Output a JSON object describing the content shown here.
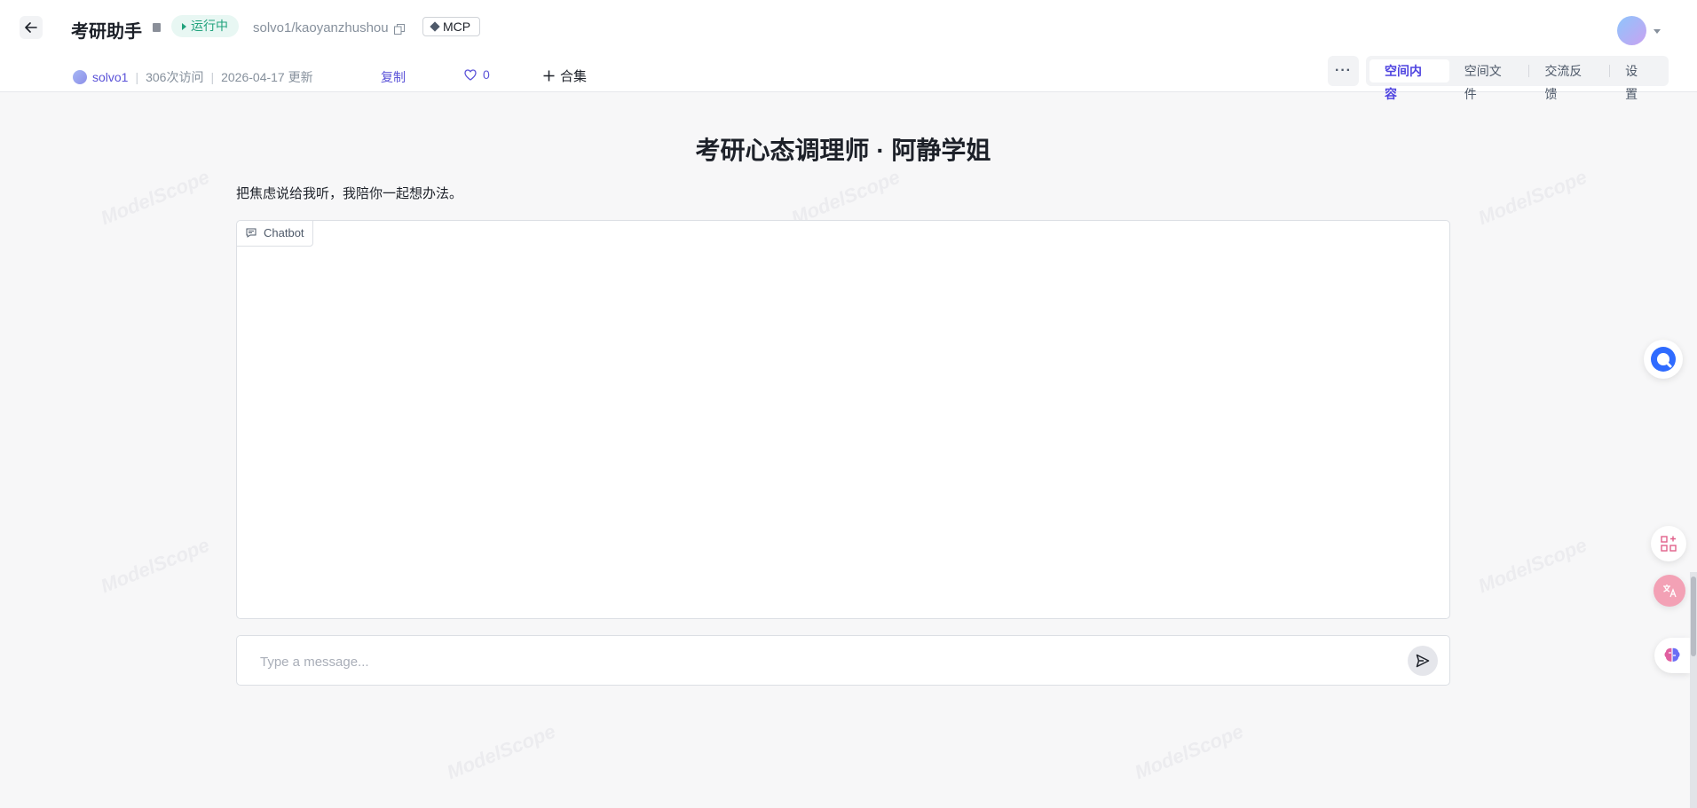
{
  "header": {
    "title": "考研助手",
    "status": "运行中",
    "repo": "solvo1/kaoyanzhushou",
    "badge": "MCP",
    "author": "solvo1",
    "visits": "306次访问",
    "updated": "2026-04-17 更新",
    "copy_label": "复制",
    "likes": "0",
    "collect_label": "合集",
    "more_label": "···"
  },
  "tabs": [
    {
      "label": "空间内容",
      "active": true
    },
    {
      "label": "空间文件",
      "active": false
    },
    {
      "label": "交流反馈",
      "active": false
    },
    {
      "label": "设置",
      "active": false
    }
  ],
  "app": {
    "title": "考研心态调理师 · 阿静学姐",
    "subtitle": "把焦虑说给我听，我陪你一起想办法。",
    "chatbot_label": "Chatbot",
    "input_placeholder": "Type a message...",
    "watermark": "ModelScope"
  },
  "colors": {
    "accent": "#4f44e0",
    "status_green": "#20a27c"
  },
  "icons": {
    "back": "arrow-left-icon",
    "send": "send-icon",
    "heart": "heart-icon",
    "plus": "plus-icon",
    "copy": "copy-icon",
    "chat": "chat-bubble-icon"
  }
}
